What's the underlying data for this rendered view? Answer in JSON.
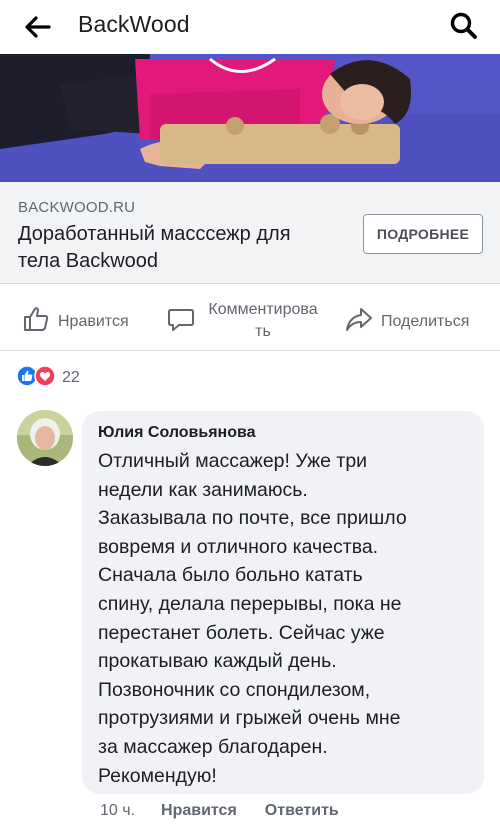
{
  "header": {
    "title": "BackWood"
  },
  "link_card": {
    "domain": "BACKWOOD.RU",
    "title": "Доработанный масссежр для тела Backwood",
    "button_label": "ПОДРОБНЕЕ"
  },
  "actions": {
    "like_label": "Нравится",
    "comment_label_line1": "Комментирова",
    "comment_label_line2": "ть",
    "share_label": "Поделиться"
  },
  "reactions": {
    "count": "22"
  },
  "comment": {
    "author": "Юлия Соловьянова",
    "lines": [
      "Отличный массажер! Уже три",
      "недели как занимаюсь.",
      "Заказывала по почте, все пришло",
      "вовремя и отличного качества.",
      "Сначала было больно катать",
      "спину, делала перерывы, пока не",
      "перестанет болеть. Сейчас уже",
      "прокатываю каждый день.",
      "Позвоночник со спондилезом,",
      "протрузиями и грыжей очень мне",
      "за массажер благодарен.",
      "Рекомендую!"
    ],
    "time": "10 ч.",
    "like_label": "Нравится",
    "reply_label": "Ответить"
  },
  "colors": {
    "like_blue": "#1877f2",
    "love_red": "#f33e58",
    "mat_purple": "#5456c8",
    "shirt_pink": "#e2197a"
  }
}
